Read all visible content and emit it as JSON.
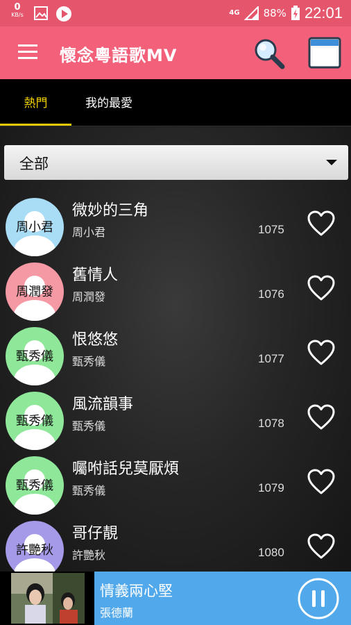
{
  "status_bar": {
    "speed_value": "0",
    "speed_unit": "KB/s",
    "network": "4G",
    "battery": "88%",
    "time": "22:01"
  },
  "app_bar": {
    "title": "懷念粵語歌MV"
  },
  "tabs": [
    {
      "label": "熱門",
      "active": true
    },
    {
      "label": "我的最愛",
      "active": false
    }
  ],
  "filter": {
    "selected": "全部"
  },
  "songs": [
    {
      "title": "微妙的三角",
      "artist": "周小君",
      "number": "1075",
      "avatar_label": "周小君",
      "avatar_color": "#a9dcf5"
    },
    {
      "title": "舊情人",
      "artist": "周潤發",
      "number": "1076",
      "avatar_label": "周潤發",
      "avatar_color": "#f59aa5"
    },
    {
      "title": "恨悠悠",
      "artist": "甄秀儀",
      "number": "1077",
      "avatar_label": "甄秀儀",
      "avatar_color": "#8fe89a"
    },
    {
      "title": "風流韻事",
      "artist": "甄秀儀",
      "number": "1078",
      "avatar_label": "甄秀儀",
      "avatar_color": "#8fe89a"
    },
    {
      "title": "囑咐話兒莫厭煩",
      "artist": "甄秀儀",
      "number": "1079",
      "avatar_label": "甄秀儀",
      "avatar_color": "#8fe89a"
    },
    {
      "title": "哥仔靚",
      "artist": "許艷秋",
      "number": "1080",
      "avatar_label": "許艷秋",
      "avatar_color": "#a59ae8"
    }
  ],
  "player": {
    "title": "情義兩心堅",
    "artist": "張德蘭"
  },
  "colors": {
    "status_bar": "#e5566c",
    "app_bar": "#f2607a",
    "tab_active": "#f0d000",
    "player_panel": "#51a8ea"
  }
}
